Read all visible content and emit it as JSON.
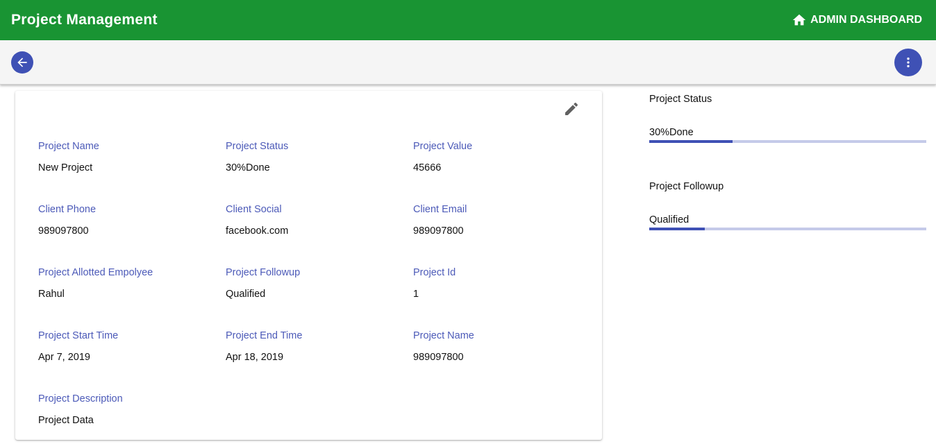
{
  "appbar": {
    "title": "Project Management",
    "dashboard_label": "ADMIN DASHBOARD",
    "dashboard_icon": "home-icon",
    "color": "#199433"
  },
  "toolbar": {
    "back_icon": "arrow-left-icon",
    "more_icon": "more-vert-icon",
    "accent": "#3f51b5"
  },
  "details": {
    "edit_icon": "pencil-icon",
    "fields": [
      {
        "label": "Project Name",
        "value": "New Project"
      },
      {
        "label": "Project Status",
        "value": "30%Done"
      },
      {
        "label": "Project Value",
        "value": "45666"
      },
      {
        "label": "Client Phone",
        "value": "989097800"
      },
      {
        "label": "Client Social",
        "value": "facebook.com"
      },
      {
        "label": "Client Email",
        "value": "989097800"
      },
      {
        "label": "Project Allotted Empolyee",
        "value": "Rahul"
      },
      {
        "label": "Project Followup",
        "value": "Qualified"
      },
      {
        "label": "Project Id",
        "value": "1"
      },
      {
        "label": "Project Start Time",
        "value": "Apr 7, 2019"
      },
      {
        "label": "Project End Time",
        "value": "Apr 18, 2019"
      },
      {
        "label": "Project Name",
        "value": "989097800"
      },
      {
        "label": "Project Description",
        "value": "Project Data"
      }
    ]
  },
  "sidebar": {
    "status": {
      "title": "Project Status",
      "value": "30%Done",
      "progress": 0.3
    },
    "followup": {
      "title": "Project Followup",
      "value": "Qualified",
      "progress": 0.2
    }
  }
}
